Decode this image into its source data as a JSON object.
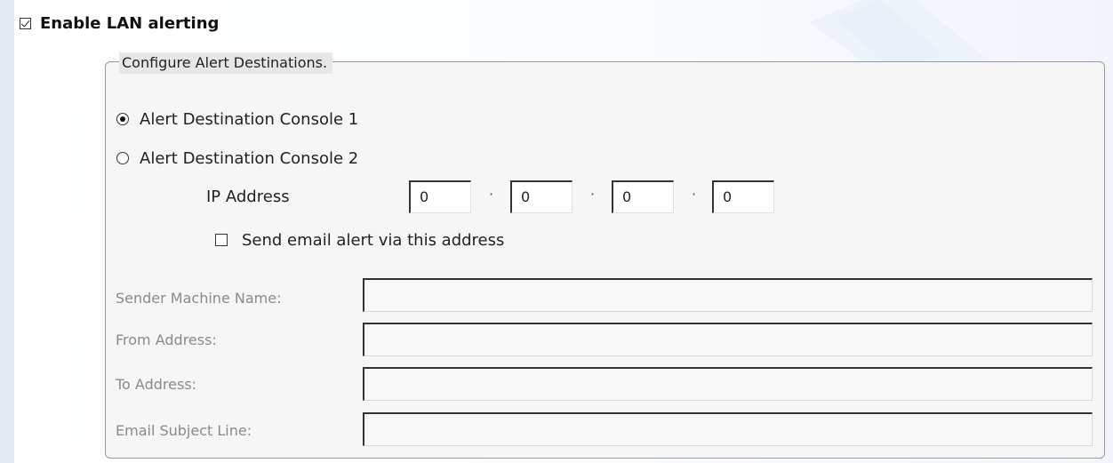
{
  "enable_lan_alerting": {
    "label": "Enable LAN alerting",
    "checked": true
  },
  "alert_group": {
    "legend": "Configure Alert Destinations.",
    "options": [
      {
        "label": "Alert Destination Console 1",
        "selected": true
      },
      {
        "label": "Alert Destination Console 2",
        "selected": false
      }
    ],
    "ip_address": {
      "label": "IP Address",
      "octets": [
        "0",
        "0",
        "0",
        "0"
      ],
      "separator": "·"
    },
    "send_email": {
      "label": "Send email alert via this address",
      "checked": false
    },
    "email_fields": [
      {
        "label": "Sender Machine Name:",
        "value": ""
      },
      {
        "label": "From Address:",
        "value": ""
      },
      {
        "label": "To Address:",
        "value": ""
      },
      {
        "label": "Email Subject Line:",
        "value": ""
      }
    ]
  },
  "colors": {
    "left_band": "#e2e9f3",
    "group_background": "#f6f6f6",
    "legend_background": "#e7e7e7",
    "disabled_label": "#8a8a8a"
  }
}
